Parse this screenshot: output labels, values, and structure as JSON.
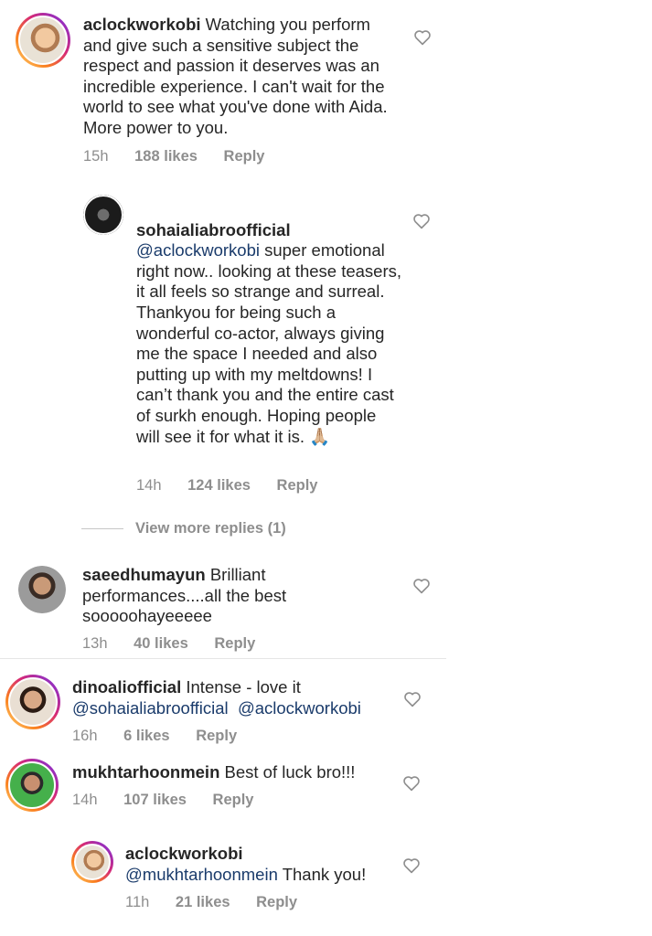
{
  "comments": [
    {
      "username": "aclockworkobi",
      "text": "Watching you perform and give such a sensitive subject the respect and passion it deserves was an incredible experience. I can't wait for the world to see what you've done with Aida. More power to you.",
      "time": "15h",
      "likes": "188 likes",
      "reply": "Reply",
      "avatar_icon": "avatar-child-photo"
    },
    {
      "username": "sohaialiabroofficial",
      "mention": "@aclockworkobi",
      "text": "super emotional right now.. looking at these teasers, it all feels so strange and surreal.\nThankyou for being such a wonderful co-actor, always giving me the space I needed and also putting up with my meltdowns! I can’t thank you and the entire cast of surkh enough. Hoping people will see it for what it is. 🙏🏼",
      "time": "14h",
      "likes": "124 likes",
      "reply": "Reply",
      "avatar_icon": "avatar-dark-photo"
    },
    {
      "view_more": "View more replies (1)"
    },
    {
      "username": "saeedhumayun",
      "text": "Brilliant performances....all the best sooooohayeeeee",
      "time": "13h",
      "likes": "40 likes",
      "reply": "Reply",
      "avatar_icon": "avatar-man-photo"
    },
    {
      "username": "dinoaliofficial",
      "text": "Intense - love it",
      "mention_1": "@sohaialiabroofficial",
      "mention_2": "@aclockworkobi",
      "time": "16h",
      "likes": "6 likes",
      "reply": "Reply",
      "avatar_icon": "avatar-man-photo"
    },
    {
      "username": "mukhtarhoonmein",
      "text": "Best of luck bro!!!",
      "time": "14h",
      "likes": "107 likes",
      "reply": "Reply",
      "avatar_icon": "avatar-man-photo"
    },
    {
      "username": "aclockworkobi",
      "mention": "@mukhtarhoonmein",
      "text": "Thank you!",
      "time": "11h",
      "likes": "21 likes",
      "reply": "Reply",
      "avatar_icon": "avatar-child-photo"
    }
  ],
  "colors": {
    "text": "#262626",
    "muted": "#8e8e8e",
    "mention": "#1a3b6b"
  }
}
